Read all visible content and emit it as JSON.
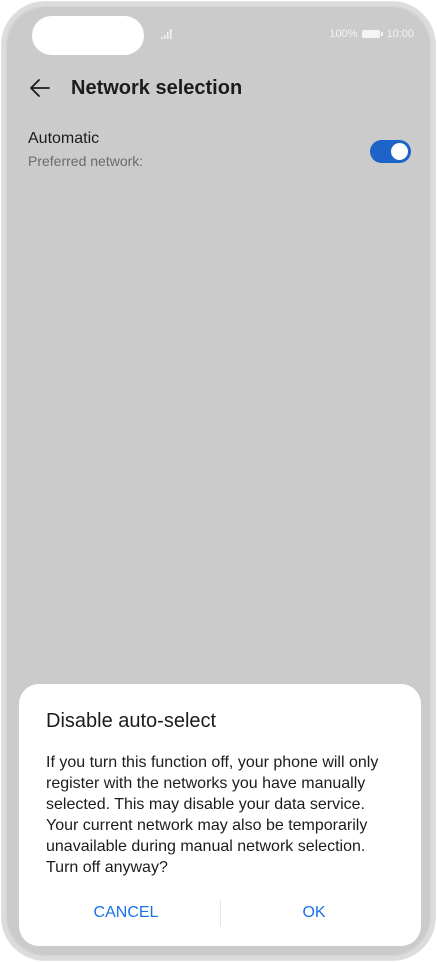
{
  "status_bar": {
    "battery_percent": "100%",
    "time": "10:00",
    "icons": [
      "signal-icon",
      "battery-icon"
    ]
  },
  "header": {
    "title": "Network selection",
    "back_icon": "back-arrow-icon"
  },
  "setting": {
    "title": "Automatic",
    "subtitle": "Preferred network:",
    "toggle_on": true
  },
  "dialog": {
    "title": "Disable auto-select",
    "message": "If you turn this function off, your phone will only register with the networks you have manually selected. This may disable your data service. Your current network may also be temporarily unavailable during manual network selection. Turn off anyway?",
    "cancel_label": "CANCEL",
    "ok_label": "OK"
  },
  "colors": {
    "accent": "#1a73e8",
    "toggle": "#1d63c8",
    "scrim": "#cbcbcb"
  }
}
